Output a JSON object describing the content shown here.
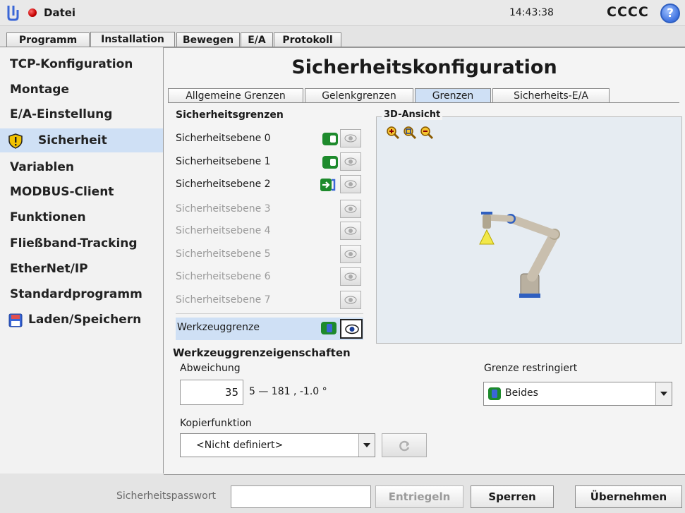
{
  "topbar": {
    "file_menu": "Datei",
    "clock": "14:43:38",
    "robot_name": "CCCC",
    "help": "?"
  },
  "main_tabs": [
    "Programm",
    "Installation",
    "Bewegen",
    "E/A",
    "Protokoll"
  ],
  "nav": {
    "items": [
      "TCP-Konfiguration",
      "Montage",
      "E/A-Einstellung",
      "Sicherheit",
      "Variablen",
      "MODBUS-Client",
      "Funktionen",
      "Fließband-Tracking",
      "EtherNet/IP",
      "Standardprogramm",
      "Laden/Speichern"
    ],
    "selected": "Sicherheit"
  },
  "page": {
    "title": "Sicherheitskonfiguration",
    "subtabs": [
      "Allgemeine Grenzen",
      "Gelenkgrenzen",
      "Grenzen",
      "Sicherheits-E/A"
    ],
    "active_subtab": "Grenzen"
  },
  "limits": {
    "title": "Sicherheitsgrenzen",
    "planes": [
      {
        "label": "Sicherheitsebene 0",
        "state": "enabled"
      },
      {
        "label": "Sicherheitsebene 1",
        "state": "enabled"
      },
      {
        "label": "Sicherheitsebene 2",
        "state": "trigger"
      },
      {
        "label": "Sicherheitsebene 3",
        "state": "disabled"
      },
      {
        "label": "Sicherheitsebene 4",
        "state": "disabled"
      },
      {
        "label": "Sicherheitsebene 5",
        "state": "disabled"
      },
      {
        "label": "Sicherheitsebene 6",
        "state": "disabled"
      },
      {
        "label": "Sicherheitsebene 7",
        "state": "disabled"
      }
    ],
    "tool_limit": "Werkzeuggrenze"
  },
  "view3d": {
    "title": "3D-Ansicht"
  },
  "properties": {
    "title": "Werkzeuggrenzeigenschaften",
    "deviation_label": "Abweichung",
    "deviation_value": "35",
    "deviation_range": "5 — 181 , -1.0 °",
    "restricted_label": "Grenze restringiert",
    "restricted_value": "Beides",
    "copy_label": "Kopierfunktion",
    "copy_value": "<Nicht definiert>"
  },
  "bottom": {
    "password_label": "Sicherheitspasswort",
    "unlock": "Entriegeln",
    "lock": "Sperren",
    "apply": "Übernehmen"
  }
}
